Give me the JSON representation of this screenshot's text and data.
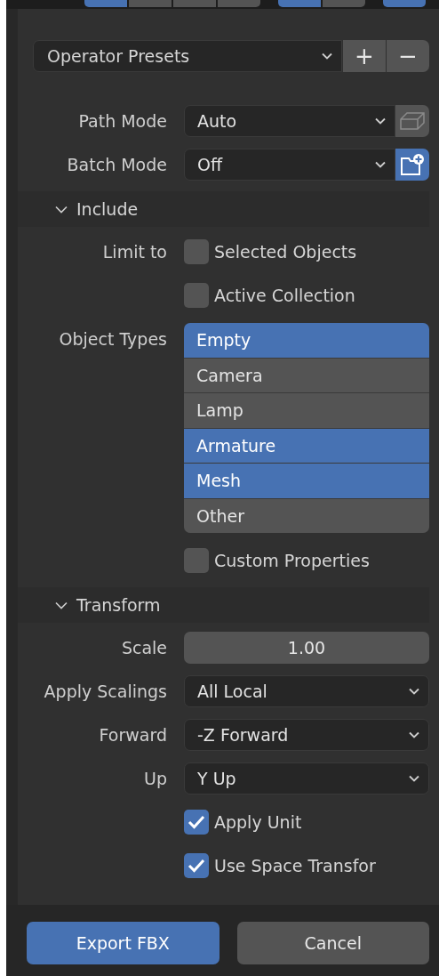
{
  "toolbar": [
    {
      "buttons": [
        {
          "selected": true
        },
        {
          "selected": false
        },
        {
          "selected": false
        },
        {
          "selected": false
        }
      ]
    },
    {
      "buttons": [
        {
          "selected": true
        },
        {
          "selected": false
        }
      ]
    },
    {
      "buttons": [
        {
          "selected": true
        }
      ]
    }
  ],
  "presets": {
    "label": "Operator Presets",
    "add": "+",
    "remove": "−"
  },
  "rows": [
    {
      "kind": "dropdown",
      "label": "Path Mode",
      "value": "Auto",
      "toggle": {
        "kind": "box",
        "selected": false
      }
    },
    {
      "kind": "dropdown",
      "label": "Batch Mode",
      "value": "Off",
      "toggle": {
        "kind": "folder-add",
        "selected": true
      }
    }
  ],
  "panels": [
    {
      "title": "Include",
      "expanded": true,
      "rows": [
        {
          "kind": "checkbox",
          "label": "Limit to",
          "text": "Selected Objects",
          "checked": false
        },
        {
          "kind": "checkbox",
          "text": "Active Collection",
          "checked": false
        },
        {
          "kind": "list",
          "label": "Object Types",
          "items": [
            {
              "text": "Empty",
              "selected": true
            },
            {
              "text": "Camera",
              "selected": false
            },
            {
              "text": "Lamp",
              "selected": false
            },
            {
              "text": "Armature",
              "selected": true
            },
            {
              "text": "Mesh",
              "selected": true
            },
            {
              "text": "Other",
              "selected": false
            }
          ]
        },
        {
          "kind": "checkbox",
          "text": "Custom Properties",
          "checked": false
        }
      ]
    },
    {
      "title": "Transform",
      "expanded": true,
      "rows": [
        {
          "kind": "number",
          "label": "Scale",
          "value": "1.00"
        },
        {
          "kind": "dropdown",
          "label": "Apply Scalings",
          "value": "All Local"
        },
        {
          "kind": "dropdown",
          "label": "Forward",
          "value": "-Z Forward"
        },
        {
          "kind": "dropdown",
          "label": "Up",
          "value": "Y Up"
        },
        {
          "kind": "checkbox",
          "text": "Apply Unit",
          "checked": true
        },
        {
          "kind": "checkbox",
          "text": "Use Space Transfor",
          "checked": true
        }
      ]
    }
  ],
  "buttons": [
    {
      "label": "Export FBX",
      "kind": "primary"
    },
    {
      "label": "Cancel",
      "kind": "secondary"
    }
  ]
}
